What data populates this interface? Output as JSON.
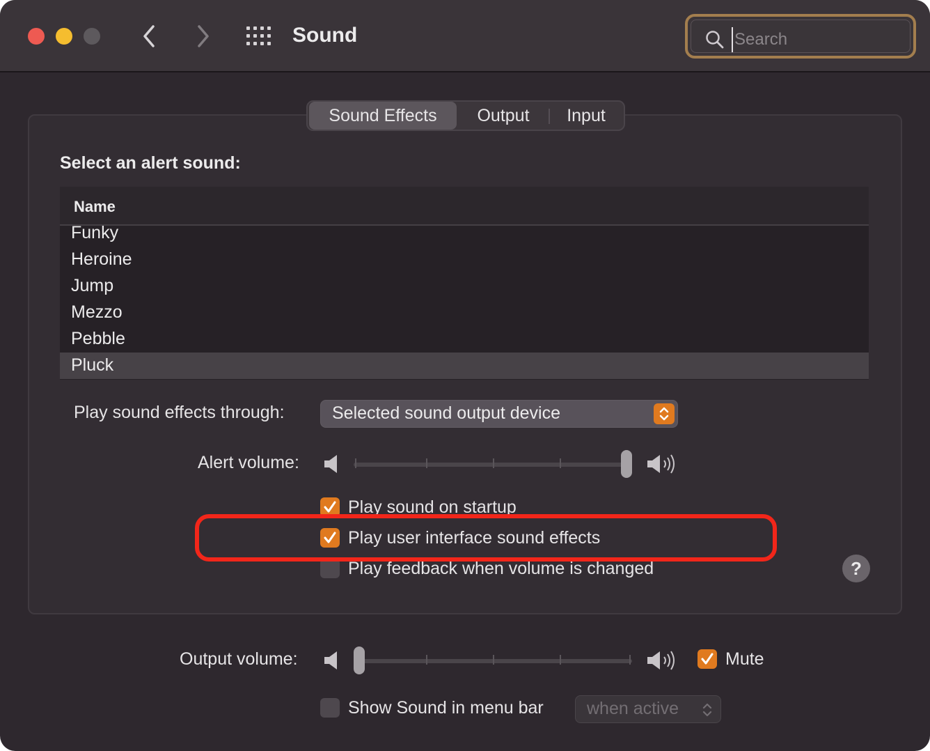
{
  "window": {
    "title": "Sound",
    "search_placeholder": "Search"
  },
  "tabs": [
    {
      "label": "Sound Effects",
      "selected": true
    },
    {
      "label": "Output",
      "selected": false
    },
    {
      "label": "Input",
      "selected": false
    }
  ],
  "alert_sounds": {
    "heading": "Select an alert sound:",
    "column_header": "Name",
    "items": [
      {
        "name": "Funky",
        "selected": false
      },
      {
        "name": "Heroine",
        "selected": false
      },
      {
        "name": "Jump",
        "selected": false
      },
      {
        "name": "Mezzo",
        "selected": false
      },
      {
        "name": "Pebble",
        "selected": false
      },
      {
        "name": "Pluck",
        "selected": true
      }
    ]
  },
  "play_through": {
    "label": "Play sound effects through:",
    "value": "Selected sound output device"
  },
  "alert_volume": {
    "label": "Alert volume:",
    "level": 1.0
  },
  "options": [
    {
      "label": "Play sound on startup",
      "checked": true
    },
    {
      "label": "Play user interface sound effects",
      "checked": true
    },
    {
      "label": "Play feedback when volume is changed",
      "checked": false
    }
  ],
  "help_label": "?",
  "output_volume": {
    "label": "Output volume:",
    "level": 0.0,
    "mute_label": "Mute",
    "mute_checked": true
  },
  "menu_bar": {
    "label": "Show Sound in menu bar",
    "checked": false,
    "popup_value": "when active"
  },
  "colors": {
    "accent": "#e07a1f",
    "highlight": "#f2261a"
  }
}
